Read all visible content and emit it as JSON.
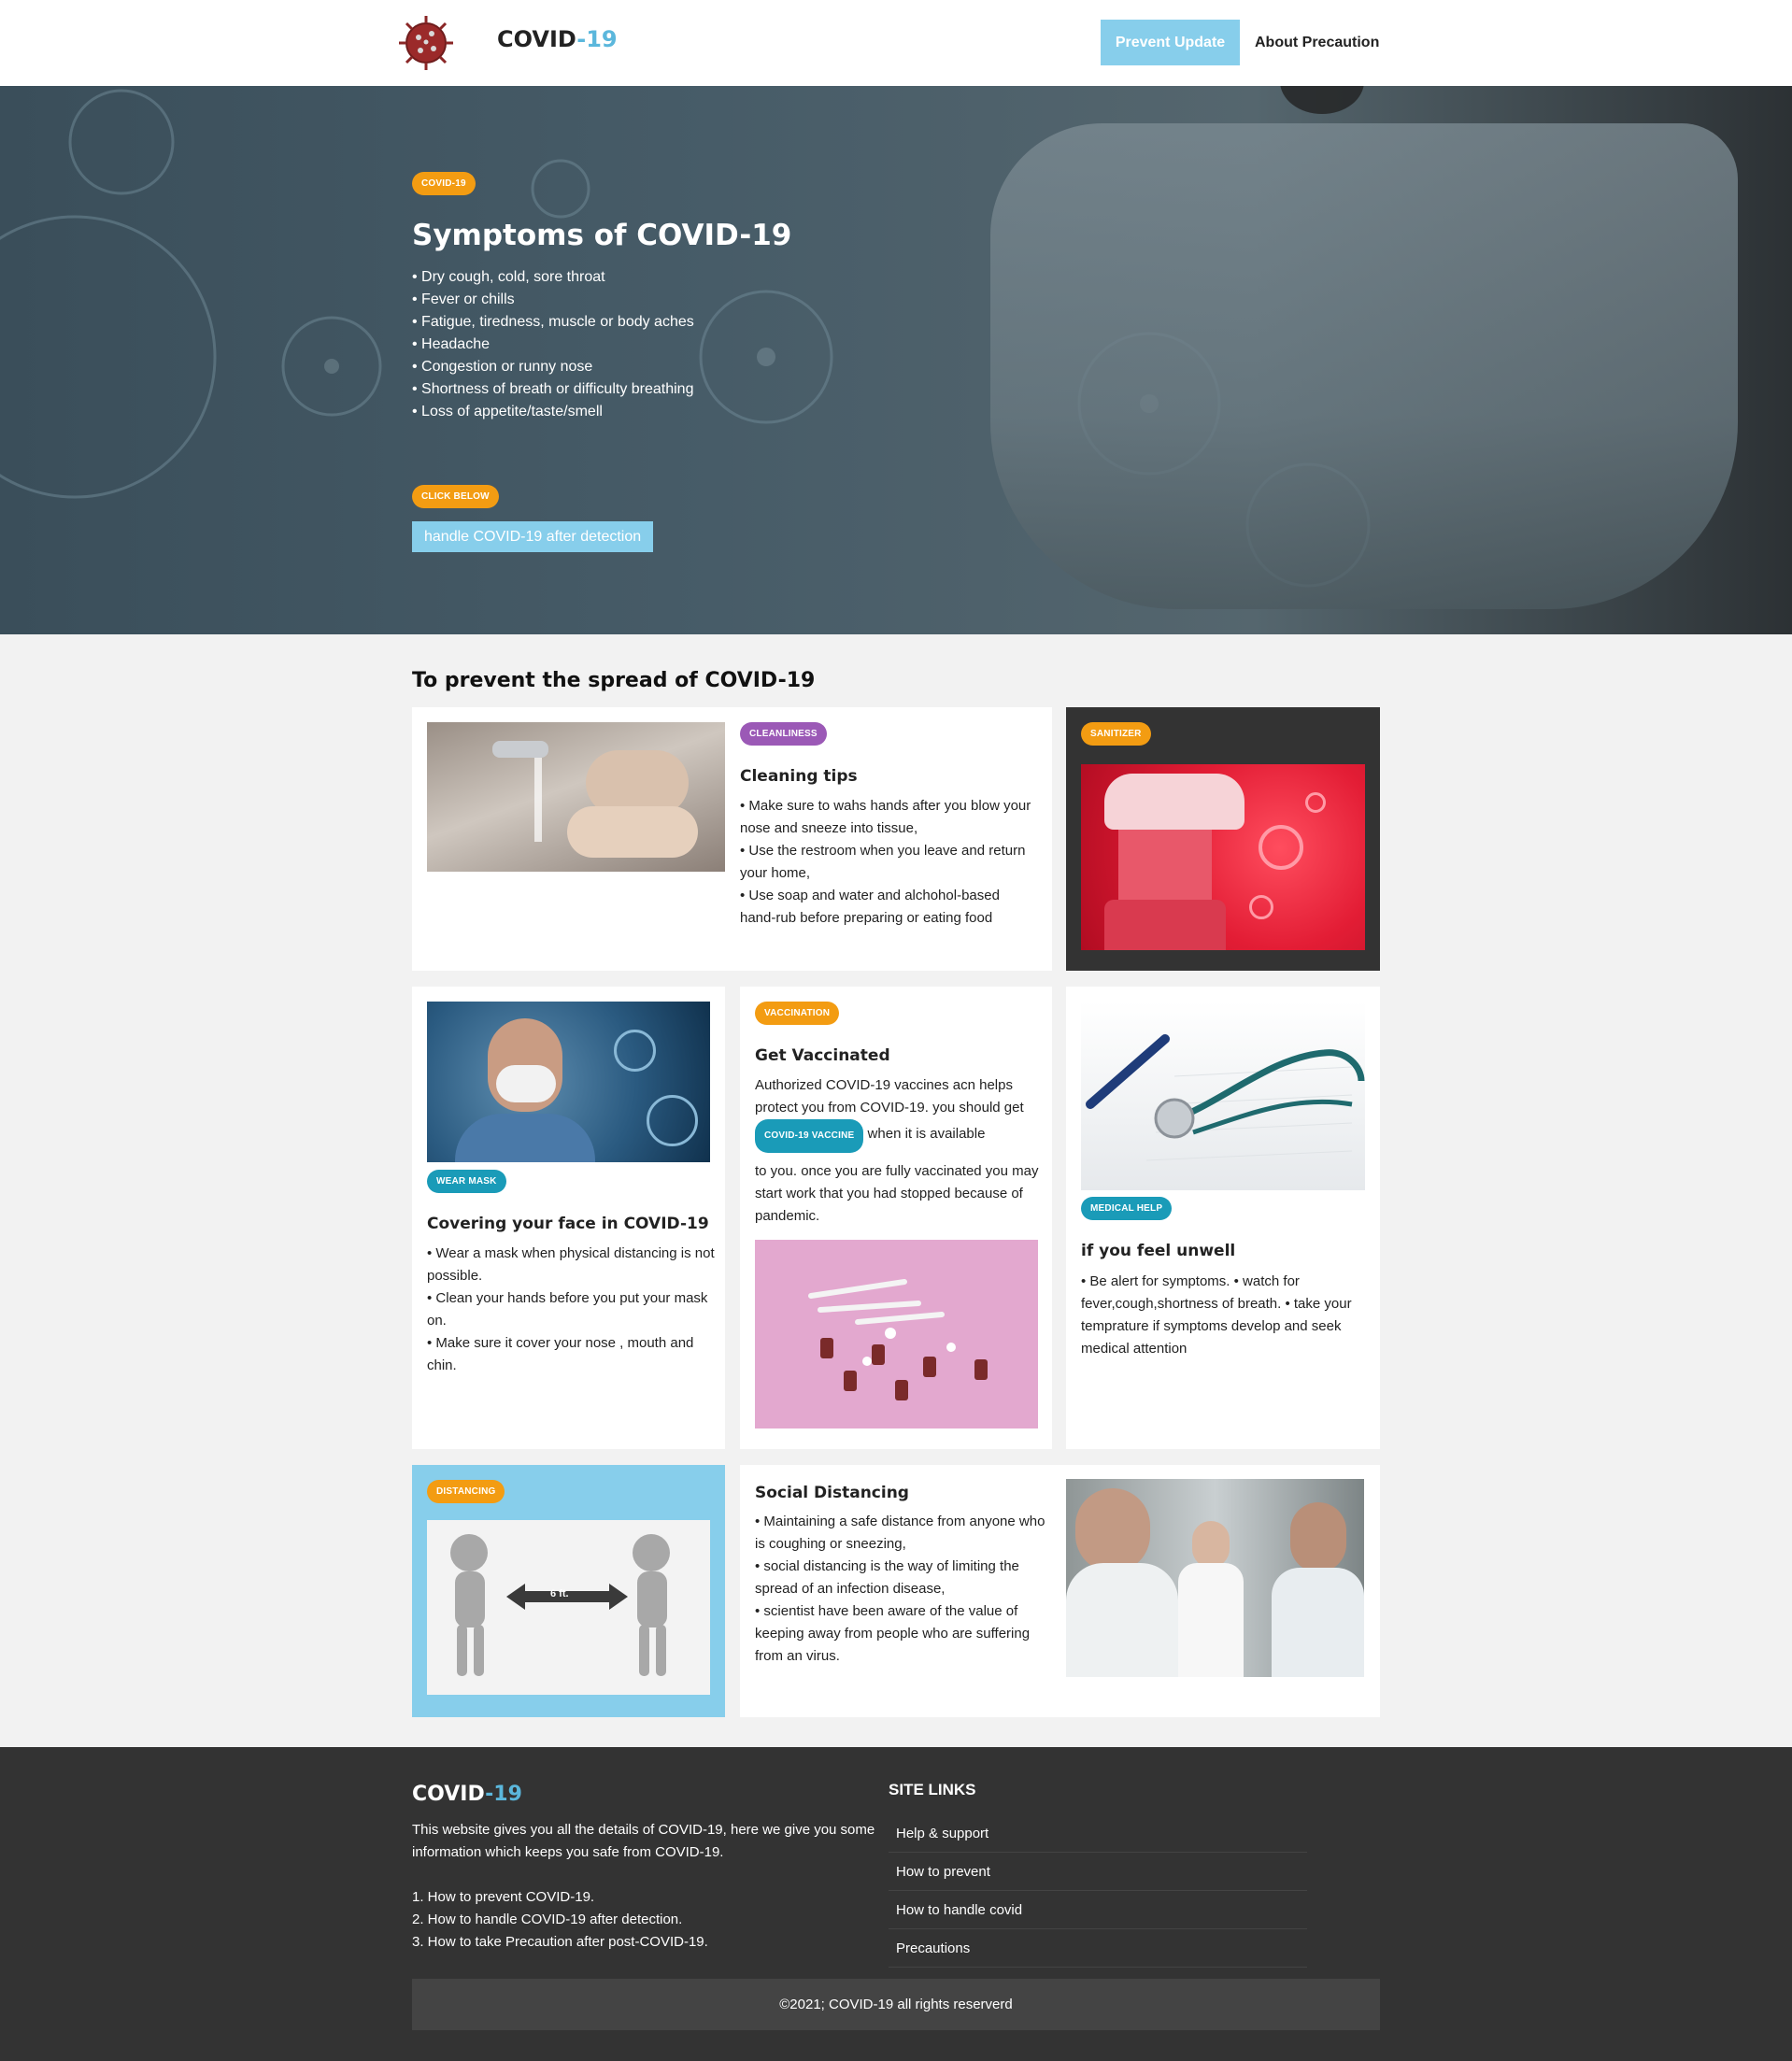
{
  "header": {
    "brand_main": "COVID",
    "brand_accent": "-19",
    "nav": [
      "Prevent Update",
      "About Precaution"
    ]
  },
  "hero": {
    "tag": "COVID-19",
    "title": "Symptoms of COVID-19",
    "symptoms": [
      "• Dry cough, cold, sore throat",
      "• Fever or chills",
      "• Fatigue, tiredness, muscle or body aches",
      "• Headache",
      "• Congestion or runny nose",
      "• Shortness of breath or difficulty breathing",
      "• Loss of appetite/taste/smell"
    ],
    "cta_tag": "CLICK BELOW",
    "cta_button": "handle COVID-19 after detection"
  },
  "prevent": {
    "title": "To prevent the spread of COVID-19",
    "cleaning": {
      "tag": "CLEANLINESS",
      "title": "Cleaning tips",
      "lines": [
        "• Make sure to wahs hands after you blow your nose and sneeze into tissue,",
        "• Use the restroom when you leave and return your home,",
        "• Use soap and water and alchohol-based hand-rub before preparing or eating food"
      ]
    },
    "sanitizer": {
      "tag": "SANITIZER"
    },
    "mask": {
      "tag": "WEAR MASK",
      "title": "Covering your face in COVID-19",
      "lines": [
        "• Wear a mask when physical distancing is not possible.",
        "• Clean your hands before you put your mask on.",
        "• Make sure it cover your nose , mouth and chin."
      ]
    },
    "vaccine": {
      "tag": "VACCINATION",
      "title": "Get Vaccinated",
      "text_a": "Authorized COVID-19 vaccines acn helps protect you from COVID-19. you should get",
      "inline_tag": "COVID-19 VACCINE",
      "text_b": "when it is available",
      "text_c": "to you. once you are fully vaccinated you may start work that you had stopped because of pandemic."
    },
    "unwell": {
      "tag": "MEDICAL HELP",
      "title": "if you feel unwell",
      "text": "• Be alert for symptoms. • watch for fever,cough,shortness of breath. • take your temprature if symptoms develop and seek medical attention"
    },
    "distancing": {
      "tag": "DISTANCING",
      "sign": "6 ft."
    },
    "social": {
      "title": "Social Distancing",
      "lines": [
        "• Maintaining a safe distance from anyone who is coughing or sneezing,",
        "• social distancing is the way of limiting the spread of an infection disease,",
        "• scientist have been aware of the value of keeping away from people who are suffering from an virus."
      ]
    }
  },
  "footer": {
    "brand_main": "COVID",
    "brand_accent": "-19",
    "description": "This website gives you all the details of COVID-19, here we give you some information which keeps you safe from COVID-19.",
    "list": [
      "1. How to prevent COVID-19.",
      "2. How to handle COVID-19 after detection.",
      "3. How to take Precaution after post-COVID-19."
    ],
    "links_title": "SITE LINKS",
    "links": [
      "Help & support",
      "How to prevent",
      "How to handle covid",
      "Precautions"
    ],
    "copyright": "©2021; COVID-19 all rights reserverd"
  },
  "colors": {
    "accent_blue": "#87ceeb",
    "brand_accent": "#5bb7dc",
    "tag_orange": "#f39c12",
    "tag_purple": "#9b59b6",
    "tag_teal": "#1a9bb8",
    "footer_bg": "#333333"
  }
}
